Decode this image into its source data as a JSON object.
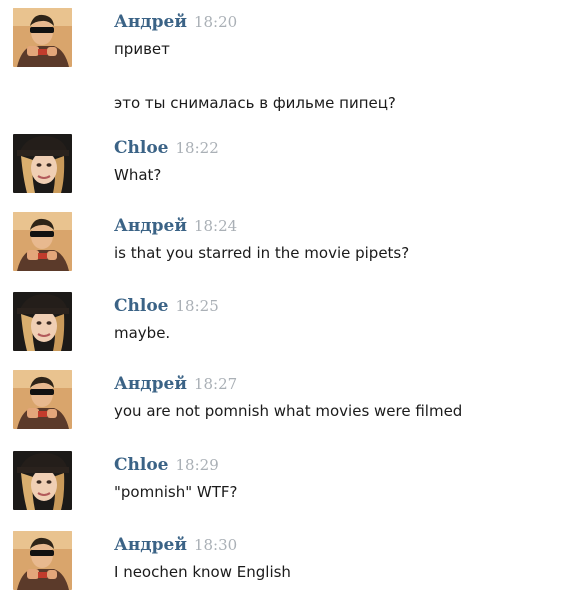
{
  "colors": {
    "author_name": "#3b6386",
    "timestamp": "#aab0b6",
    "message_text": "#1b1b1b",
    "background": "#ffffff"
  },
  "messages": [
    {
      "author": "Андрей",
      "time": "18:20",
      "avatar": "andrey-avatar",
      "lines": [
        "привет",
        "это ты снималась в фильме пипец?"
      ]
    },
    {
      "author": "Chloe",
      "time": "18:22",
      "avatar": "chloe-avatar",
      "lines": [
        "What?"
      ]
    },
    {
      "author": "Андрей",
      "time": "18:24",
      "avatar": "andrey-avatar",
      "lines": [
        "is that you starred in the movie pipets?"
      ]
    },
    {
      "author": "Chloe",
      "time": "18:25",
      "avatar": "chloe-avatar",
      "lines": [
        "maybe."
      ]
    },
    {
      "author": "Андрей",
      "time": "18:27",
      "avatar": "andrey-avatar",
      "lines": [
        "you are not pomnish what movies were filmed"
      ]
    },
    {
      "author": "Chloe",
      "time": "18:29",
      "avatar": "chloe-avatar",
      "lines": [
        "\"pomnish\" WTF?"
      ]
    },
    {
      "author": "Андрей",
      "time": "18:30",
      "avatar": "andrey-avatar",
      "lines": [
        "I neochen know English"
      ]
    }
  ]
}
